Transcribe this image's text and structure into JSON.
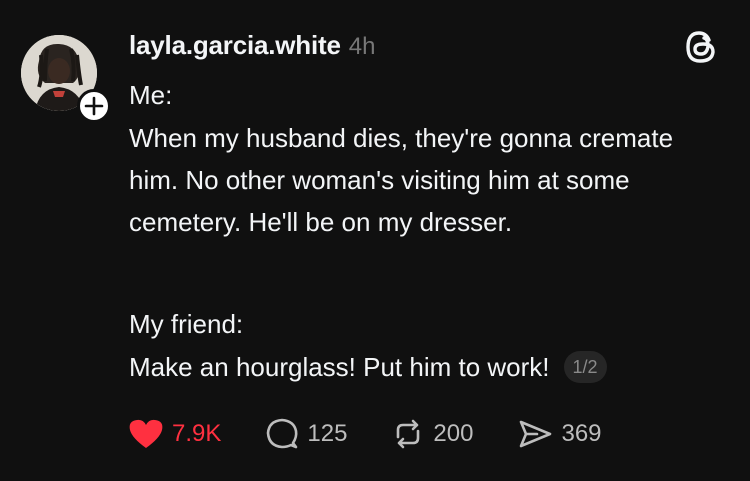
{
  "post": {
    "username": "layla.garcia.white",
    "time": "4h",
    "text_intro": "Me:",
    "text_body": "When my husband dies, they're gonna cremate him. No other woman's visiting him at some cemetery. He'll be on my dresser.",
    "text_friend_label": "My friend:",
    "text_friend_reply": "Make an hourglass! Put him to work!",
    "pager": "1/2"
  },
  "actions": {
    "likes": "7.9K",
    "replies": "125",
    "reposts": "200",
    "shares": "369"
  },
  "icons": {
    "avatar": "profile-photo",
    "follow": "plus-icon",
    "logo": "threads-logo-icon",
    "like": "heart-icon",
    "reply": "speech-bubble-icon",
    "repost": "repost-icon",
    "share": "send-icon"
  },
  "colors": {
    "background": "#101010",
    "text": "#f3f5f7",
    "muted": "#777777",
    "like_active": "#ff3040"
  }
}
